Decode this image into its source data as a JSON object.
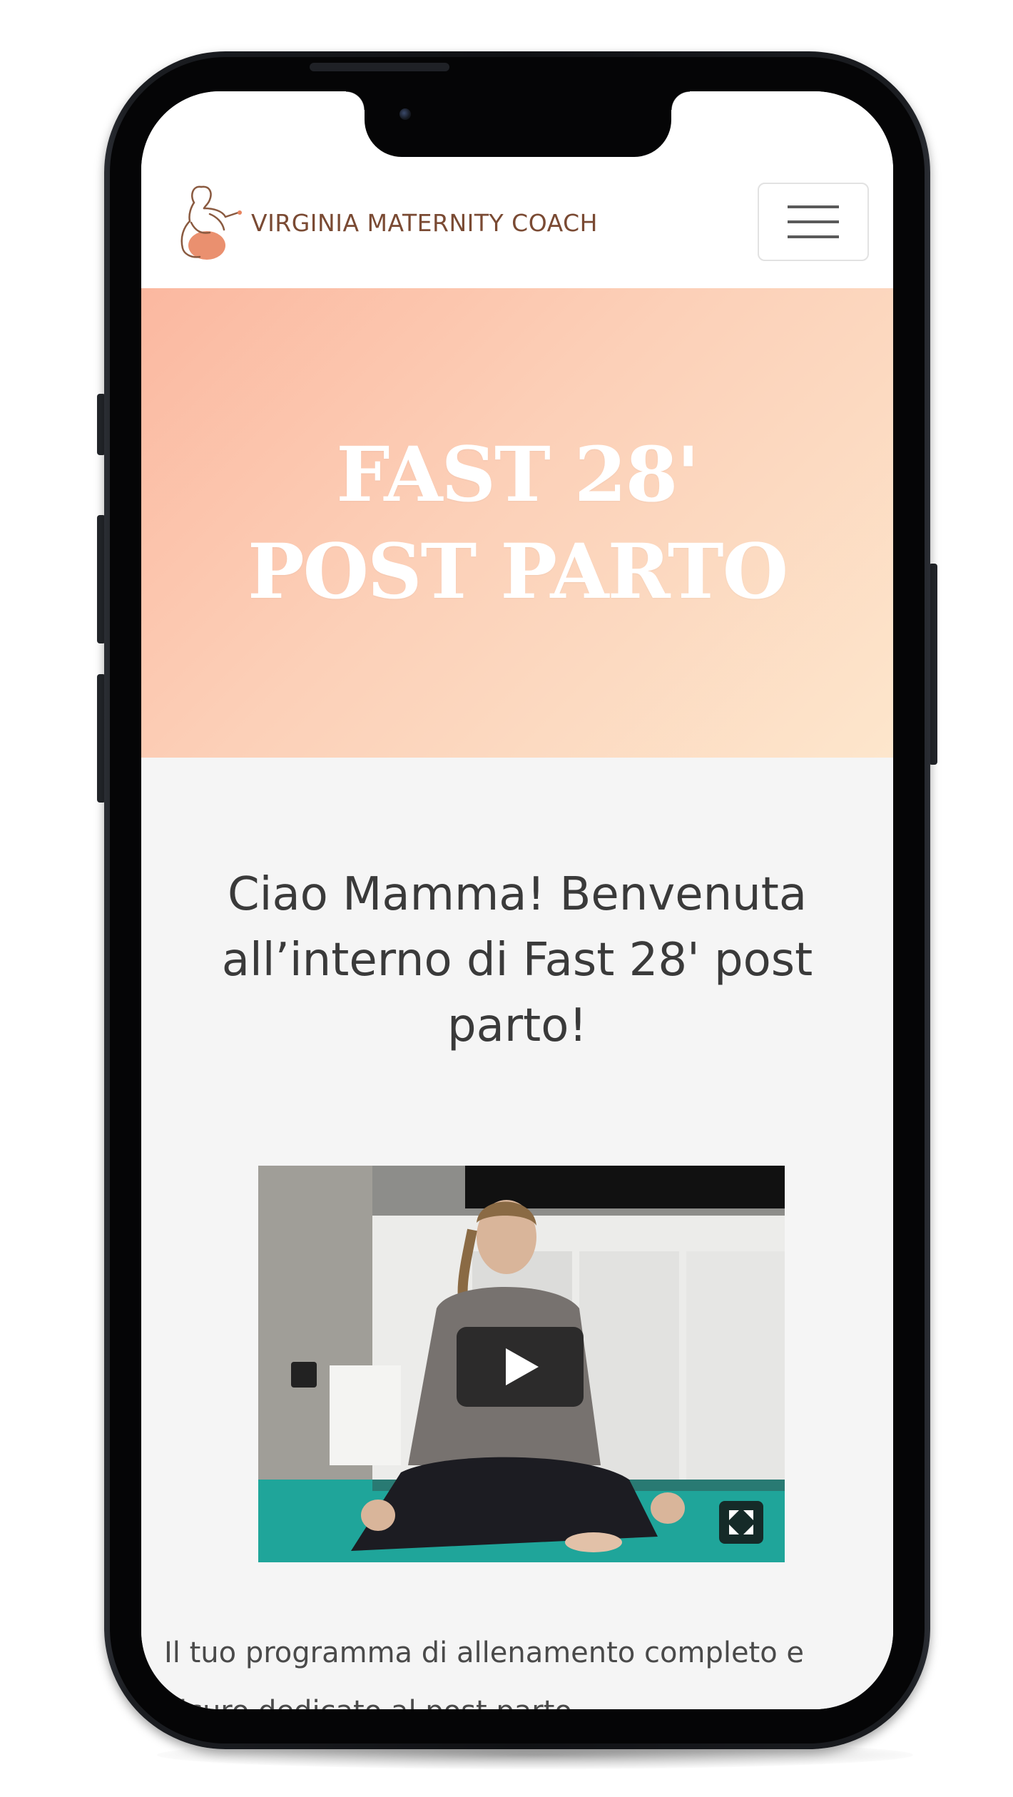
{
  "navbar": {
    "brand_name": "VIRGINIA MATERNITY COACH",
    "logo_icon": "pregnant-woman-logo-icon",
    "menu_icon": "hamburger-menu-icon"
  },
  "hero": {
    "title": "FAST 28' POST PARTO"
  },
  "content": {
    "welcome_heading": "Ciao Mamma! Benvenuta all’interno di Fast 28' post parto!",
    "video": {
      "play_icon": "play-icon",
      "fullscreen_icon": "fullscreen-icon"
    },
    "intro_text": "Il tuo programma di allenamento completo e sicuro dedicato al post parto."
  },
  "colors": {
    "brand_text": "#7a4a33",
    "hero_gradient_start": "#fbb8a0",
    "hero_gradient_end": "#fde6cc",
    "page_background": "#f5f5f5",
    "heading_text": "#3a3a3a"
  }
}
